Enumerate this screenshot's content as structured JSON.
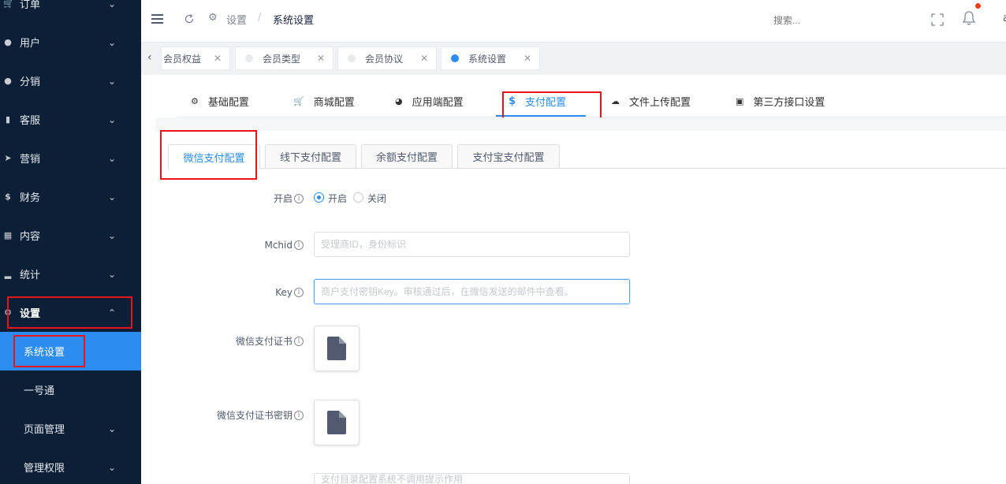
{
  "sidebar": {
    "items": [
      {
        "label": "订单",
        "icon": "cart-icon",
        "has_chevron": true
      },
      {
        "label": "用户",
        "icon": "user-icon",
        "has_chevron": true
      },
      {
        "label": "分销",
        "icon": "group-icon",
        "has_chevron": true
      },
      {
        "label": "客服",
        "icon": "chat-icon",
        "has_chevron": true
      },
      {
        "label": "营销",
        "icon": "send-icon",
        "has_chevron": true
      },
      {
        "label": "财务",
        "icon": "dollar-icon",
        "has_chevron": true
      },
      {
        "label": "内容",
        "icon": "book-icon",
        "has_chevron": true
      },
      {
        "label": "统计",
        "icon": "bar-chart-icon",
        "has_chevron": true
      },
      {
        "label": "设置",
        "icon": "gear-icon",
        "expanded": true
      }
    ],
    "sub_items": [
      {
        "label": "系统设置",
        "active": true
      },
      {
        "label": "一号通"
      },
      {
        "label": "页面管理",
        "has_chevron": true
      },
      {
        "label": "管理权限",
        "has_chevron": true
      }
    ]
  },
  "header": {
    "breadcrumb_parent": "设置",
    "breadcrumb_separator": "/",
    "breadcrumb_current": "系统设置",
    "search_placeholder": "搜索...",
    "user_initial": "a"
  },
  "page_tabs": [
    {
      "label": "会员权益",
      "active": false
    },
    {
      "label": "会员类型",
      "active": false
    },
    {
      "label": "会员协议",
      "active": false
    },
    {
      "label": "系统设置",
      "active": true
    }
  ],
  "config_tabs": [
    {
      "label": "基础配置",
      "icon": "gear-icon"
    },
    {
      "label": "商城配置",
      "icon": "cart-icon"
    },
    {
      "label": "应用端配置",
      "icon": "pie-icon"
    },
    {
      "label": "支付配置",
      "icon": "dollar-icon",
      "active": true
    },
    {
      "label": "文件上传配置",
      "icon": "cloud-upload-icon"
    },
    {
      "label": "第三方接口设置",
      "icon": "briefcase-icon"
    }
  ],
  "payment_tabs": [
    {
      "label": "微信支付配置",
      "active": true
    },
    {
      "label": "线下支付配置"
    },
    {
      "label": "余额支付配置"
    },
    {
      "label": "支付宝支付配置"
    }
  ],
  "form": {
    "enable_label": "开启",
    "enable_options": {
      "on": "开启",
      "off": "关闭"
    },
    "enable_value": "开启",
    "mchid_label": "Mchid",
    "mchid_placeholder": "受理商ID，身份标识",
    "key_label": "Key",
    "key_placeholder": "商户支付密钥Key。审核通过后，在微信发送的邮件中查看。",
    "cert_label": "微信支付证书",
    "cert_key_label": "微信支付证书密钥",
    "next_placeholder": "支付目录配置系统不调用提示作用"
  },
  "colors": {
    "sidebar_bg": "#0c1f36",
    "accent": "#2d8cf0",
    "highlight_box": "#e8161b",
    "notification_dot": "#ed4014"
  }
}
